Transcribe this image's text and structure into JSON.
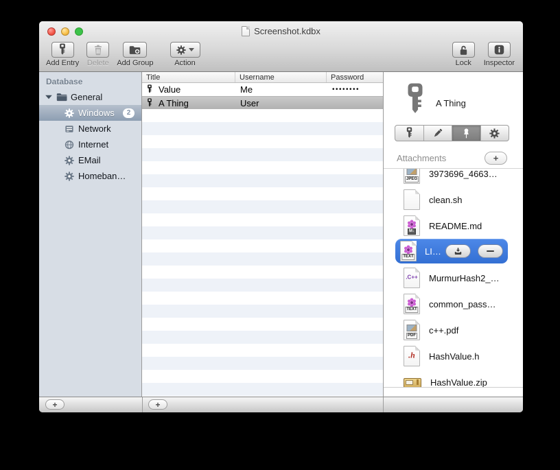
{
  "window": {
    "title": "Screenshot.kdbx"
  },
  "toolbar": {
    "add_entry": "Add Entry",
    "delete": "Delete",
    "add_group": "Add Group",
    "action": "Action",
    "lock": "Lock",
    "inspector": "Inspector",
    "icons": [
      "key-icon",
      "trash-icon",
      "folder-plus-icon",
      "gear-dropdown-icon",
      "padlock-open-icon",
      "info-icon"
    ]
  },
  "sidebar": {
    "header": "Database",
    "items": [
      {
        "label": "General",
        "icon": "folder-icon",
        "expanded": true
      },
      {
        "label": "Windows",
        "icon": "gear-icon",
        "badge": "2",
        "selected": true
      },
      {
        "label": "Network",
        "icon": "server-icon"
      },
      {
        "label": "Internet",
        "icon": "globe-icon"
      },
      {
        "label": "EMail",
        "icon": "gear-icon"
      },
      {
        "label": "Homeban…",
        "icon": "gear-icon"
      }
    ]
  },
  "table": {
    "columns": [
      "Title",
      "Username",
      "Password"
    ],
    "rows": [
      {
        "title": "Value",
        "username": "Me",
        "password": "••••••••",
        "icon": "key-icon"
      },
      {
        "title": "A Thing",
        "username": "User",
        "password": "",
        "icon": "key-icon",
        "selected": true
      }
    ]
  },
  "inspector": {
    "entry_icon": "key-icon",
    "entry_title": "A Thing",
    "tabs": [
      "key-icon",
      "pencil-icon",
      "pushpin-icon",
      "gear-icon"
    ],
    "selected_tab": 2,
    "attachments_header": "Attachments",
    "add_button": "+",
    "files": [
      {
        "name": "3973696_4663…",
        "kind": "jpeg"
      },
      {
        "name": "clean.sh",
        "kind": "plain"
      },
      {
        "name": "README.md",
        "kind": "markdown",
        "badge": "M↓"
      },
      {
        "name": "LI…",
        "kind": "text",
        "badge": "TEXT",
        "selected": true
      },
      {
        "name": "MurmurHash2_…",
        "kind": "cpp",
        "glyph": ".C++"
      },
      {
        "name": "common_pass…",
        "kind": "text",
        "badge": "TEXT"
      },
      {
        "name": "c++.pdf",
        "kind": "pdf",
        "badge": "PDF"
      },
      {
        "name": "HashValue.h",
        "kind": "c-header",
        "glyph": ".h"
      },
      {
        "name": "HashValue.zip",
        "kind": "zip"
      }
    ],
    "jpeg_badge": "JPEG"
  },
  "footer": {
    "add_group": "+",
    "add_entry": "+"
  }
}
